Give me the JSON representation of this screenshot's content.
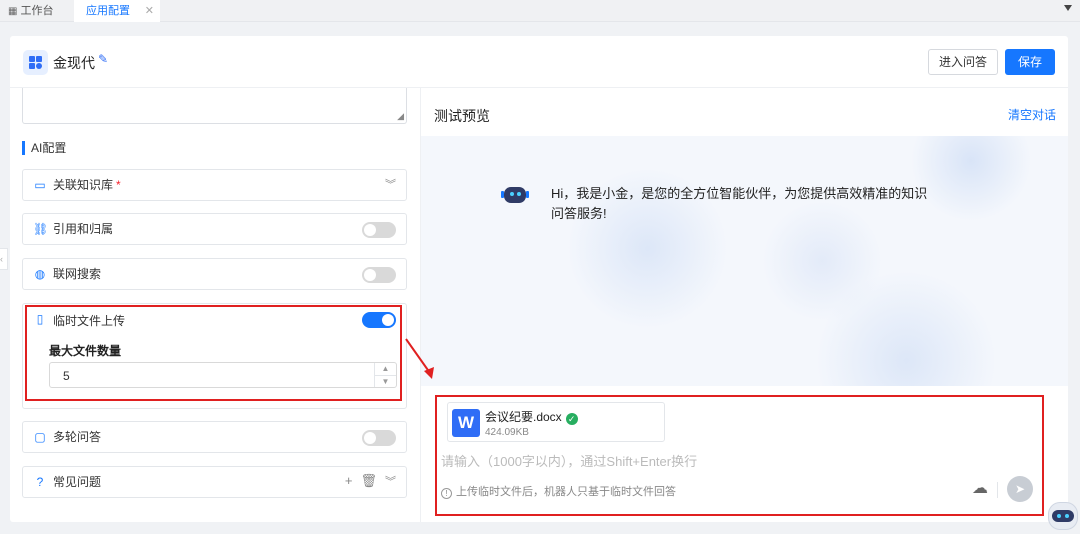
{
  "tabs": [
    {
      "label": "工作台",
      "icon": "grid-icon"
    },
    {
      "label": "应用配置",
      "active": true
    }
  ],
  "header": {
    "app_name": "金现代",
    "enter_qa_label": "进入问答",
    "save_label": "保存"
  },
  "config": {
    "section_title": "AI配置",
    "knowledge_base": {
      "label": "关联知识库",
      "required_mark": "*"
    },
    "citation": {
      "label": "引用和归属",
      "enabled": false
    },
    "web_search": {
      "label": "联网搜索",
      "enabled": false
    },
    "temp_upload": {
      "label": "临时文件上传",
      "enabled": true,
      "max_files_label": "最大文件数量",
      "max_files_value": "5"
    },
    "multi_turn": {
      "label": "多轮问答",
      "enabled": false
    },
    "faq": {
      "label": "常见问题"
    }
  },
  "preview": {
    "title": "测试预览",
    "clear_label": "清空对话",
    "greeting": "Hi，我是小金，是您的全方位智能伙伴，为您提供高效精准的知识问答服务!"
  },
  "composer": {
    "file": {
      "name": "会议纪要.docx",
      "size": "424.09KB",
      "icon_letter": "W"
    },
    "placeholder": "请输入（1000字以内），通过Shift+Enter换行",
    "hint": "上传临时文件后，机器人只基于临时文件回答"
  },
  "colors": {
    "accent": "#1677ff",
    "annotation": "#e02020",
    "toggle_off": "#d9d9d9"
  }
}
